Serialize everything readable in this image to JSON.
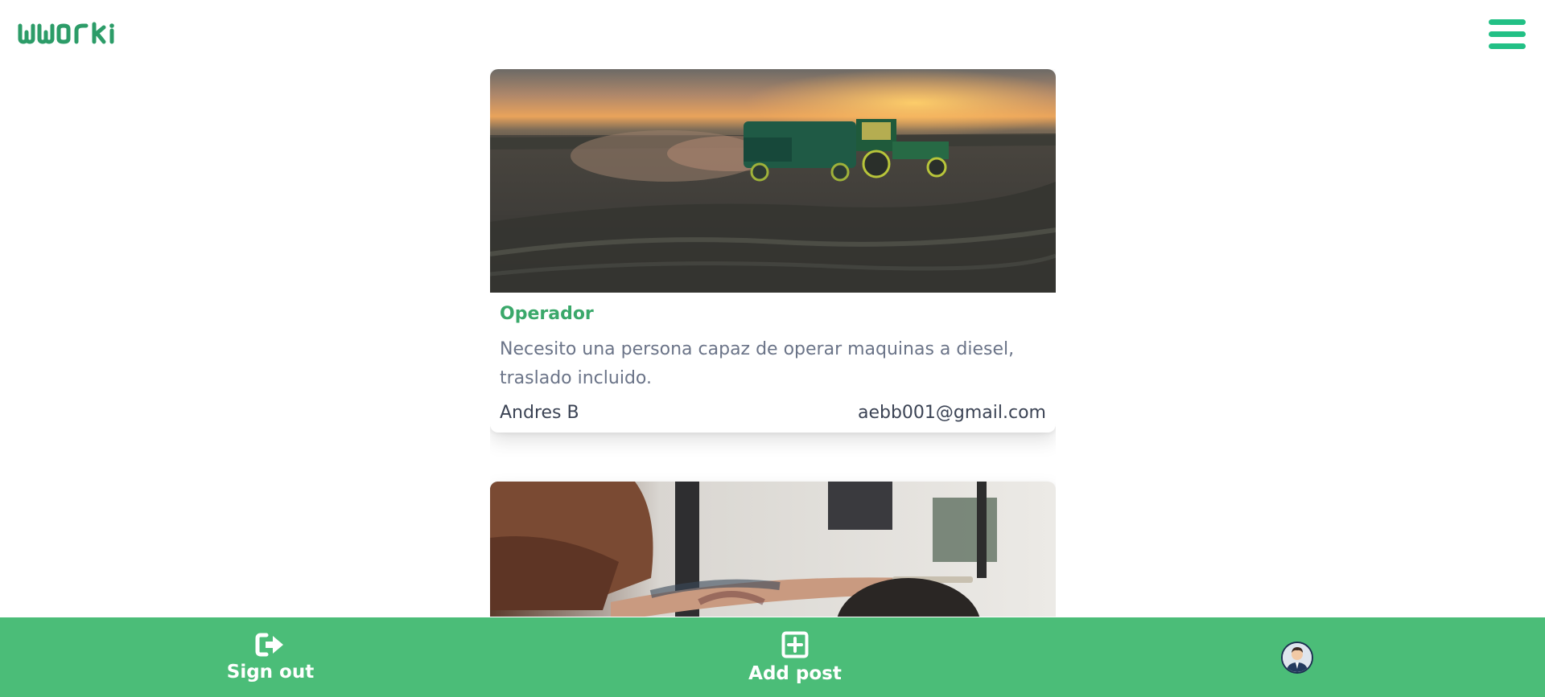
{
  "header": {
    "logo_text": "woorki",
    "menu_icon": "hamburger-menu-icon"
  },
  "posts": [
    {
      "title": "Operador",
      "description": "Necesito una persona capaz de operar maquinas a diesel, traslado incluido.",
      "author": "Andres B",
      "email": "aebb001@gmail.com",
      "image": "tractor-field-sunset-photo"
    },
    {
      "image": "barber-tattoo-haircut-photo"
    }
  ],
  "bottom_nav": {
    "sign_out_label": "Sign out",
    "sign_out_icon": "sign-out-icon",
    "add_post_label": "Add post",
    "add_post_icon": "plus-square-icon",
    "profile_icon": "user-avatar"
  },
  "colors": {
    "brand_green": "#22c085",
    "nav_green": "#4bbd78",
    "title_green": "#3aa86a",
    "text_gray": "#6b7488",
    "text_dark": "#3b4354"
  }
}
